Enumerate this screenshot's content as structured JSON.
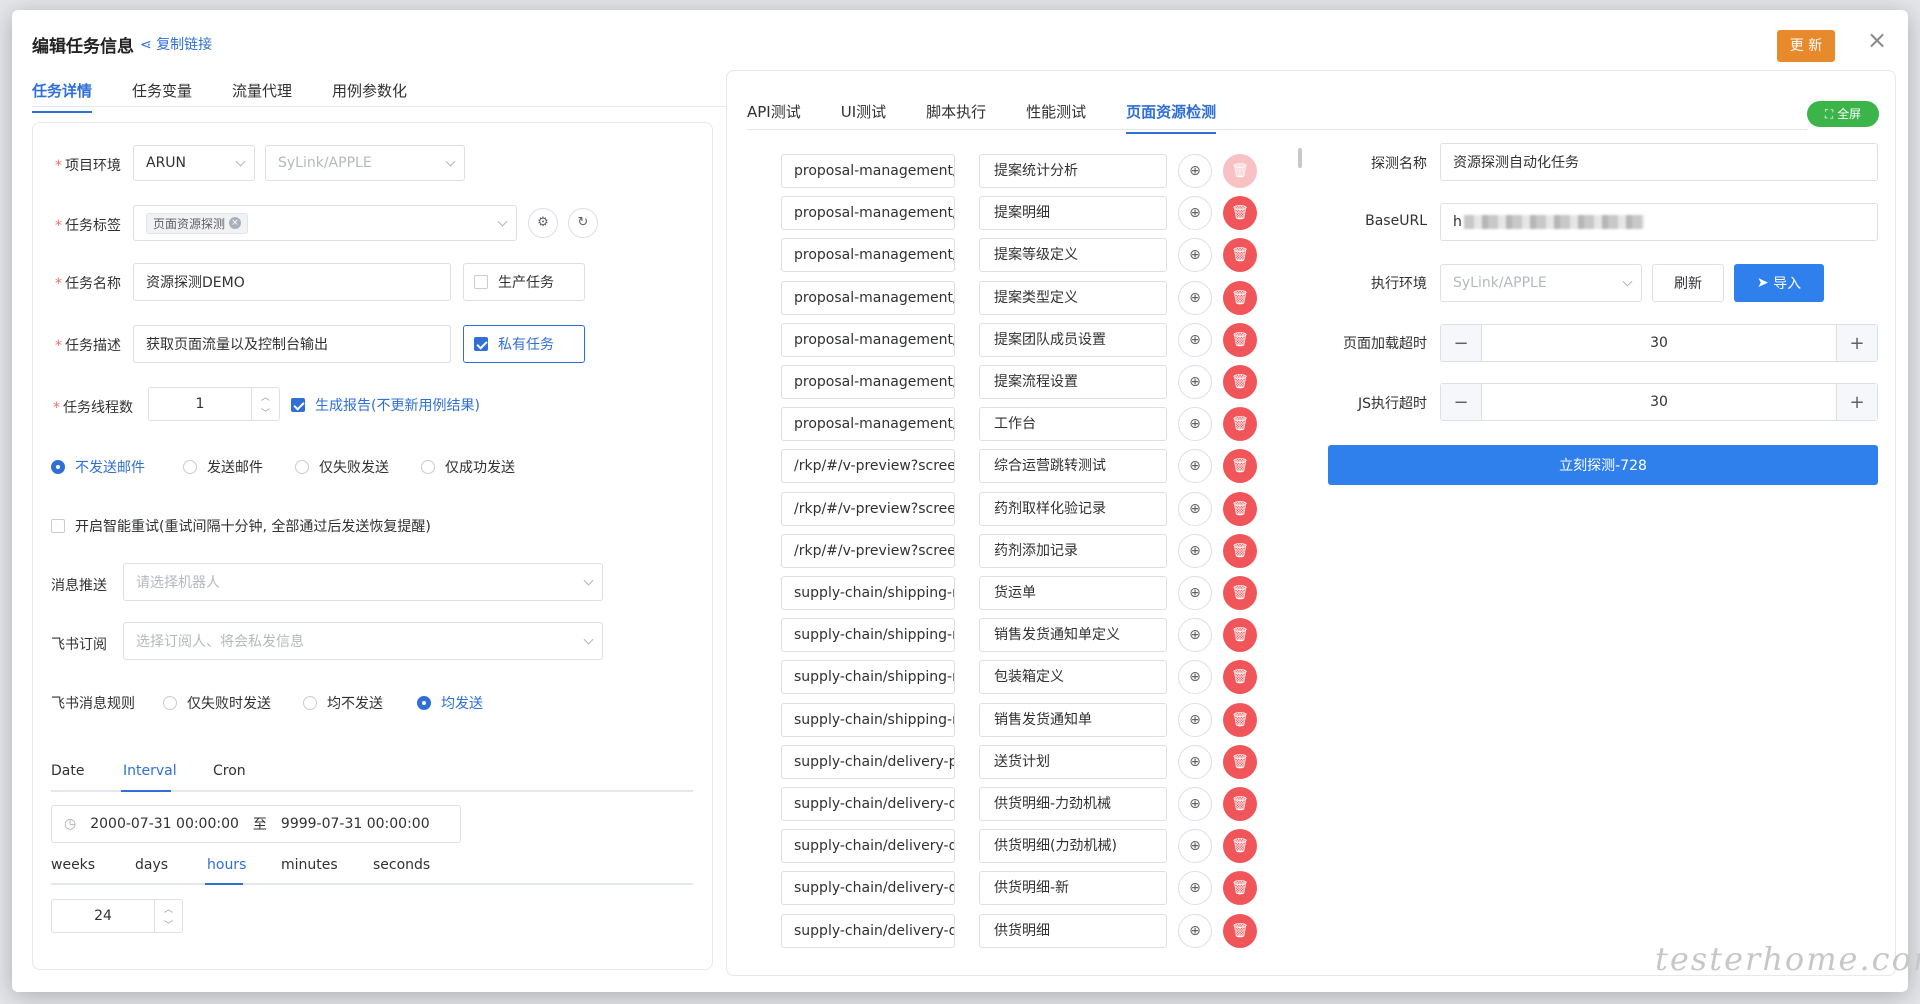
{
  "dialog": {
    "title": "编辑任务信息",
    "copy_link": "复制链接",
    "update_label": "更 新",
    "close": "×",
    "left_tabs": [
      "任务详情",
      "任务变量",
      "流量代理",
      "用例参数化"
    ]
  },
  "form": {
    "project_env_label": "项目环境",
    "project_env_value": "ARUN",
    "project_env_sub": "SyLink/APPLE",
    "task_tag_label": "任务标签",
    "task_tag_chip": "页面资源探测",
    "task_name_label": "任务名称",
    "task_name_value": "资源探测DEMO",
    "production_task": "生产任务",
    "task_desc_label": "任务描述",
    "task_desc_value": "获取页面流量以及控制台输出",
    "private_task": "私有任务",
    "thread_label": "任务线程数",
    "thread_value": "1",
    "gen_report": "生成报告(不更新用例结果)",
    "mail_options": [
      "不发送邮件",
      "发送邮件",
      "仅失败发送",
      "仅成功发送"
    ],
    "smart_retry": "开启智能重试(重试间隔十分钟, 全部通过后发送恢复提醒)",
    "msg_push_label": "消息推送",
    "msg_push_placeholder": "请选择机器人",
    "feishu_sub_label": "飞书订阅",
    "feishu_sub_placeholder": "选择订阅人、将会私发信息",
    "feishu_rule_label": "飞书消息规则",
    "feishu_rule_options": [
      "仅失败时发送",
      "均不发送",
      "均发送"
    ]
  },
  "schedule": {
    "tabs": [
      "Date",
      "Interval",
      "Cron"
    ],
    "start": "2000-07-31 00:00:00",
    "to": "至",
    "end": "9999-07-31 00:00:00",
    "units": [
      "weeks",
      "days",
      "hours",
      "minutes",
      "seconds"
    ],
    "value": "24"
  },
  "right": {
    "tabs": [
      "API测试",
      "UI测试",
      "脚本执行",
      "性能测试",
      "页面资源检测"
    ],
    "fullscreen": "全屏",
    "rows": [
      {
        "url": "proposal-management/re",
        "name": "提案统计分析"
      },
      {
        "url": "proposal-management/pi",
        "name": "提案明细"
      },
      {
        "url": "proposal-management/pi",
        "name": "提案等级定义"
      },
      {
        "url": "proposal-management/pi",
        "name": "提案类型定义"
      },
      {
        "url": "proposal-management/te",
        "name": "提案团队成员设置"
      },
      {
        "url": "proposal-management/a|",
        "name": "提案流程设置"
      },
      {
        "url": "proposal-management/w",
        "name": "工作台"
      },
      {
        "url": "/rkp/#/v-preview?screenI",
        "name": "综合运营跳转测试"
      },
      {
        "url": "/rkp/#/v-preview?screenI",
        "name": "药剂取样化验记录"
      },
      {
        "url": "/rkp/#/v-preview?screenI",
        "name": "药剂添加记录"
      },
      {
        "url": "supply-chain/shipping-ma",
        "name": "货运单"
      },
      {
        "url": "supply-chain/shipping-ma",
        "name": "销售发货通知单定义"
      },
      {
        "url": "supply-chain/shipping-ma",
        "name": "包装箱定义"
      },
      {
        "url": "supply-chain/shipping-ma",
        "name": "销售发货通知单"
      },
      {
        "url": "supply-chain/delivery-pla",
        "name": "送货计划"
      },
      {
        "url": "supply-chain/delivery-det",
        "name": "供货明细-力劲机械"
      },
      {
        "url": "supply-chain/delivery-det",
        "name": "供货明细(力劲机械)"
      },
      {
        "url": "supply-chain/delivery-det",
        "name": "供货明细-新"
      },
      {
        "url": "supply-chain/delivery-det",
        "name": "供货明细"
      }
    ],
    "probe_name_label": "探测名称",
    "probe_name_value": "资源探测自动化任务",
    "base_url_label": "BaseURL",
    "base_url_value": "h",
    "exec_env_label": "执行环境",
    "exec_env_value": "SyLink/APPLE",
    "refresh_label": "刷新",
    "import_label": "导入",
    "page_timeout_label": "页面加载超时",
    "page_timeout_value": "30",
    "js_timeout_label": "JS执行超时",
    "js_timeout_value": "30",
    "probe_now": "立刻探测-728"
  },
  "watermark": "testerhome.com",
  "colors": {
    "primary": "#2f6fd6",
    "danger": "#f0555a",
    "warning": "#e8892c",
    "success": "#3bb54a"
  }
}
